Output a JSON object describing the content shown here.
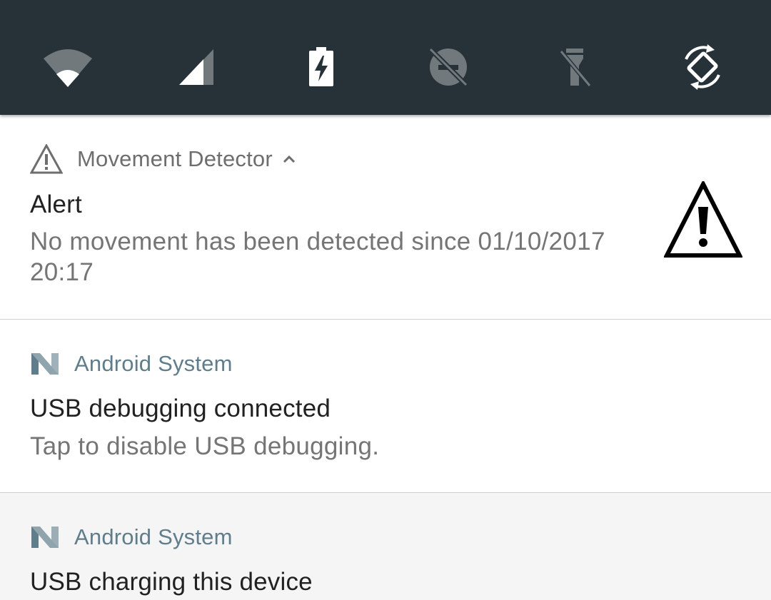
{
  "quick_settings": {
    "tiles": [
      {
        "icon": "wifi-icon",
        "state": "on"
      },
      {
        "icon": "cellular-signal-icon",
        "state": "on"
      },
      {
        "icon": "battery-charging-icon",
        "state": "on"
      },
      {
        "icon": "do-not-disturb-off-icon",
        "state": "off"
      },
      {
        "icon": "flashlight-off-icon",
        "state": "off"
      },
      {
        "icon": "auto-rotate-icon",
        "state": "on"
      }
    ],
    "background": "#263238"
  },
  "notifications": [
    {
      "app_icon": "warning-triangle-icon",
      "app_name": "Movement Detector",
      "expanded": true,
      "title": "Alert",
      "body": "No movement has been detected since 01/10/2017\n20:17",
      "large_icon": "warning-sign-icon"
    },
    {
      "app_icon": "android-n-icon",
      "app_name": "Android System",
      "title": "USB debugging connected",
      "body": "Tap to disable USB debugging."
    },
    {
      "app_icon": "android-n-icon",
      "app_name": "Android System",
      "title": "USB charging this device"
    }
  ],
  "colors": {
    "accent_app_name": "#607d8b",
    "title_text": "#212121",
    "body_text": "#757575"
  }
}
